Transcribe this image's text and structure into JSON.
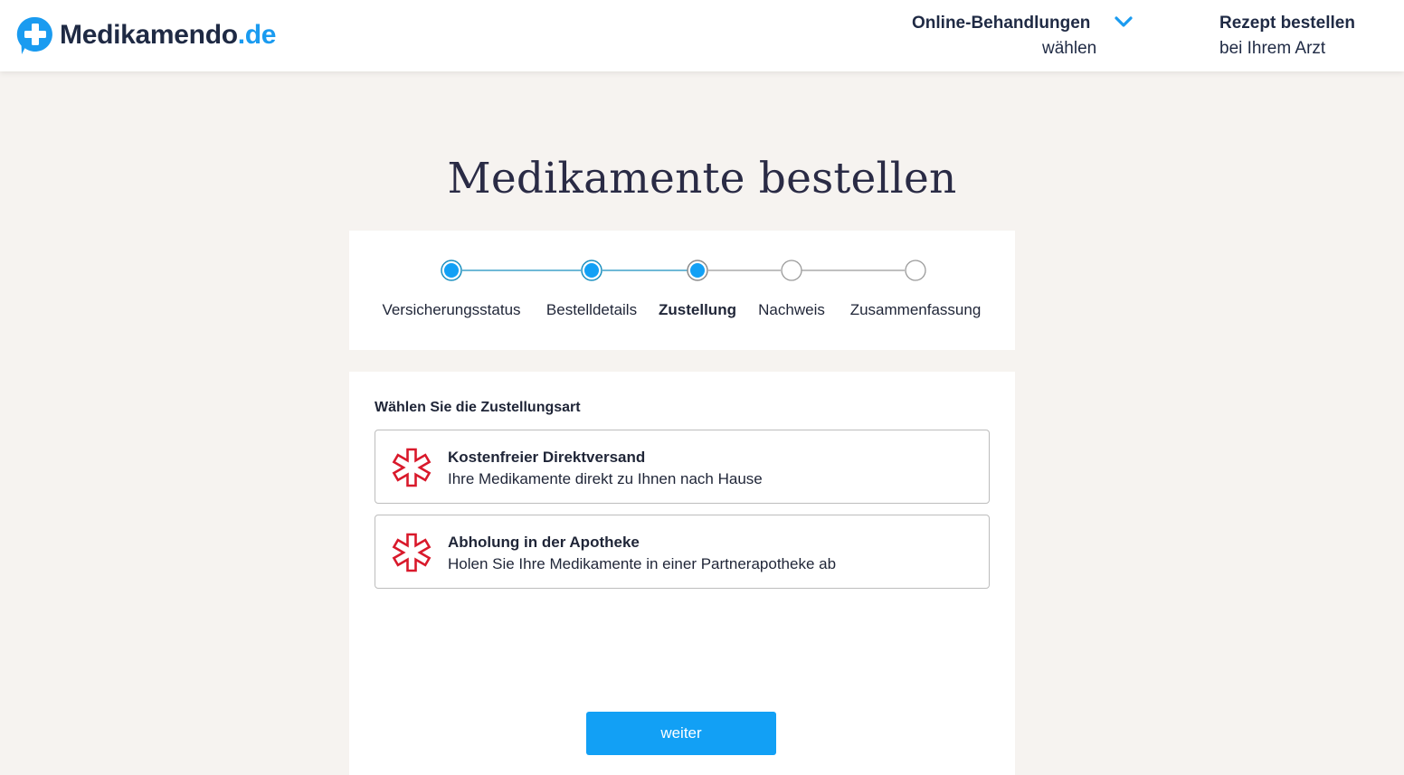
{
  "header": {
    "logo_main": "Medikamendo",
    "logo_tld": ".de",
    "nav_treatments_title": "Online-Behandlungen",
    "nav_treatments_sub": "wählen",
    "nav_prescription_title": "Rezept bestellen",
    "nav_prescription_sub": "bei Ihrem Arzt"
  },
  "page": {
    "title": "Medikamente bestellen"
  },
  "stepper": {
    "steps": [
      {
        "label": "Versicherungsstatus",
        "state": "done"
      },
      {
        "label": "Bestelldetails",
        "state": "done"
      },
      {
        "label": "Zustellung",
        "state": "current"
      },
      {
        "label": "Nachweis",
        "state": "pending"
      },
      {
        "label": "Zusammenfassung",
        "state": "pending"
      }
    ]
  },
  "delivery": {
    "heading": "Wählen Sie die Zustellungsart",
    "options": [
      {
        "title": "Kostenfreier Direktversand",
        "subtitle": "Ihre Medikamente direkt zu Ihnen nach Hause",
        "icon": "pharmacy-cross-icon"
      },
      {
        "title": "Abholung in der Apotheke",
        "subtitle": "Holen Sie Ihre Medikamente in einer Partnerapotheke ab",
        "icon": "pharmacy-cross-icon"
      }
    ],
    "continue_label": "weiter"
  },
  "colors": {
    "brand_blue": "#1a9bf0",
    "button_blue": "#12a0f5",
    "pharmacy_red": "#d9192b",
    "background": "#f6f3f0"
  }
}
